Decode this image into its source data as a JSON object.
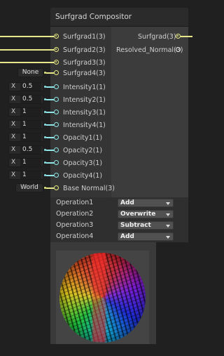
{
  "node": {
    "title": "Surfgrad Compositor",
    "inputs": [
      {
        "label": "Surfgrad1(3)"
      },
      {
        "label": "Surfgrad2(3)"
      },
      {
        "label": "Surfgrad3(3)"
      },
      {
        "label": "Surfgrad4(3)"
      },
      {
        "label": "Intensity1(1)"
      },
      {
        "label": "Intensity2(1)"
      },
      {
        "label": "Intensity3(1)"
      },
      {
        "label": "Intensity4(1)"
      },
      {
        "label": "Opacity1(1)"
      },
      {
        "label": "Opacity2(1)"
      },
      {
        "label": "Opacity3(1)"
      },
      {
        "label": "Opacity4(1)"
      },
      {
        "label": "Base Normal(3)"
      }
    ],
    "outputs": [
      {
        "label": "Surfgrad(3)"
      },
      {
        "label": "Resolved_Normal(3)"
      }
    ]
  },
  "defaults": {
    "surfgrad4": "None",
    "intensity1": {
      "axis": "X",
      "value": "0.5"
    },
    "intensity2": {
      "axis": "X",
      "value": "0.5"
    },
    "intensity3": {
      "axis": "X",
      "value": "1"
    },
    "intensity4": {
      "axis": "X",
      "value": "1"
    },
    "opacity1": {
      "axis": "X",
      "value": "1"
    },
    "opacity2": {
      "axis": "X",
      "value": "0.5"
    },
    "opacity3": {
      "axis": "X",
      "value": "1"
    },
    "opacity4": {
      "axis": "X",
      "value": "1"
    },
    "base_normal": "World"
  },
  "properties": [
    {
      "label": "Operation1",
      "value": "Add"
    },
    {
      "label": "Operation2",
      "value": "Overwrite"
    },
    {
      "label": "Operation3",
      "value": "Subtract"
    },
    {
      "label": "Operation4",
      "value": "Add"
    }
  ],
  "colors": {
    "surfgrad_port": "#e8ea82",
    "float_port": "#8ee6e6",
    "node_bg": "#393939"
  }
}
